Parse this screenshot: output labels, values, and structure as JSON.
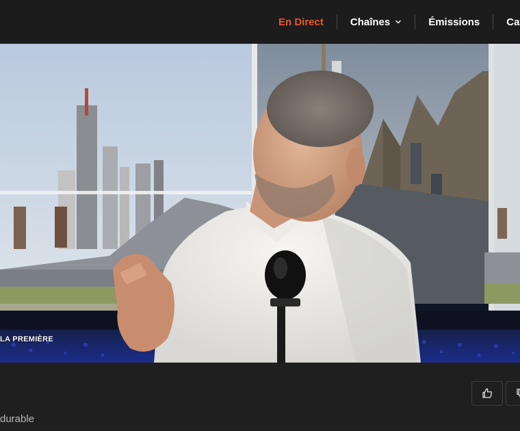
{
  "nav": {
    "items": [
      {
        "label": "En Direct",
        "active": true
      },
      {
        "label": "Chaînes",
        "has_dropdown": true
      },
      {
        "label": "Émissions"
      },
      {
        "label": "Caté"
      }
    ]
  },
  "video": {
    "channel_logo_text": "LA PREMIÈRE"
  },
  "actions": {
    "like_icon": "thumbs-up-icon",
    "dislike_icon": "thumbs-down-icon"
  },
  "description": {
    "text": "durable"
  },
  "colors": {
    "accent": "#e8582c",
    "background": "#1f1f1f",
    "topbar": "#1c1c1c"
  }
}
